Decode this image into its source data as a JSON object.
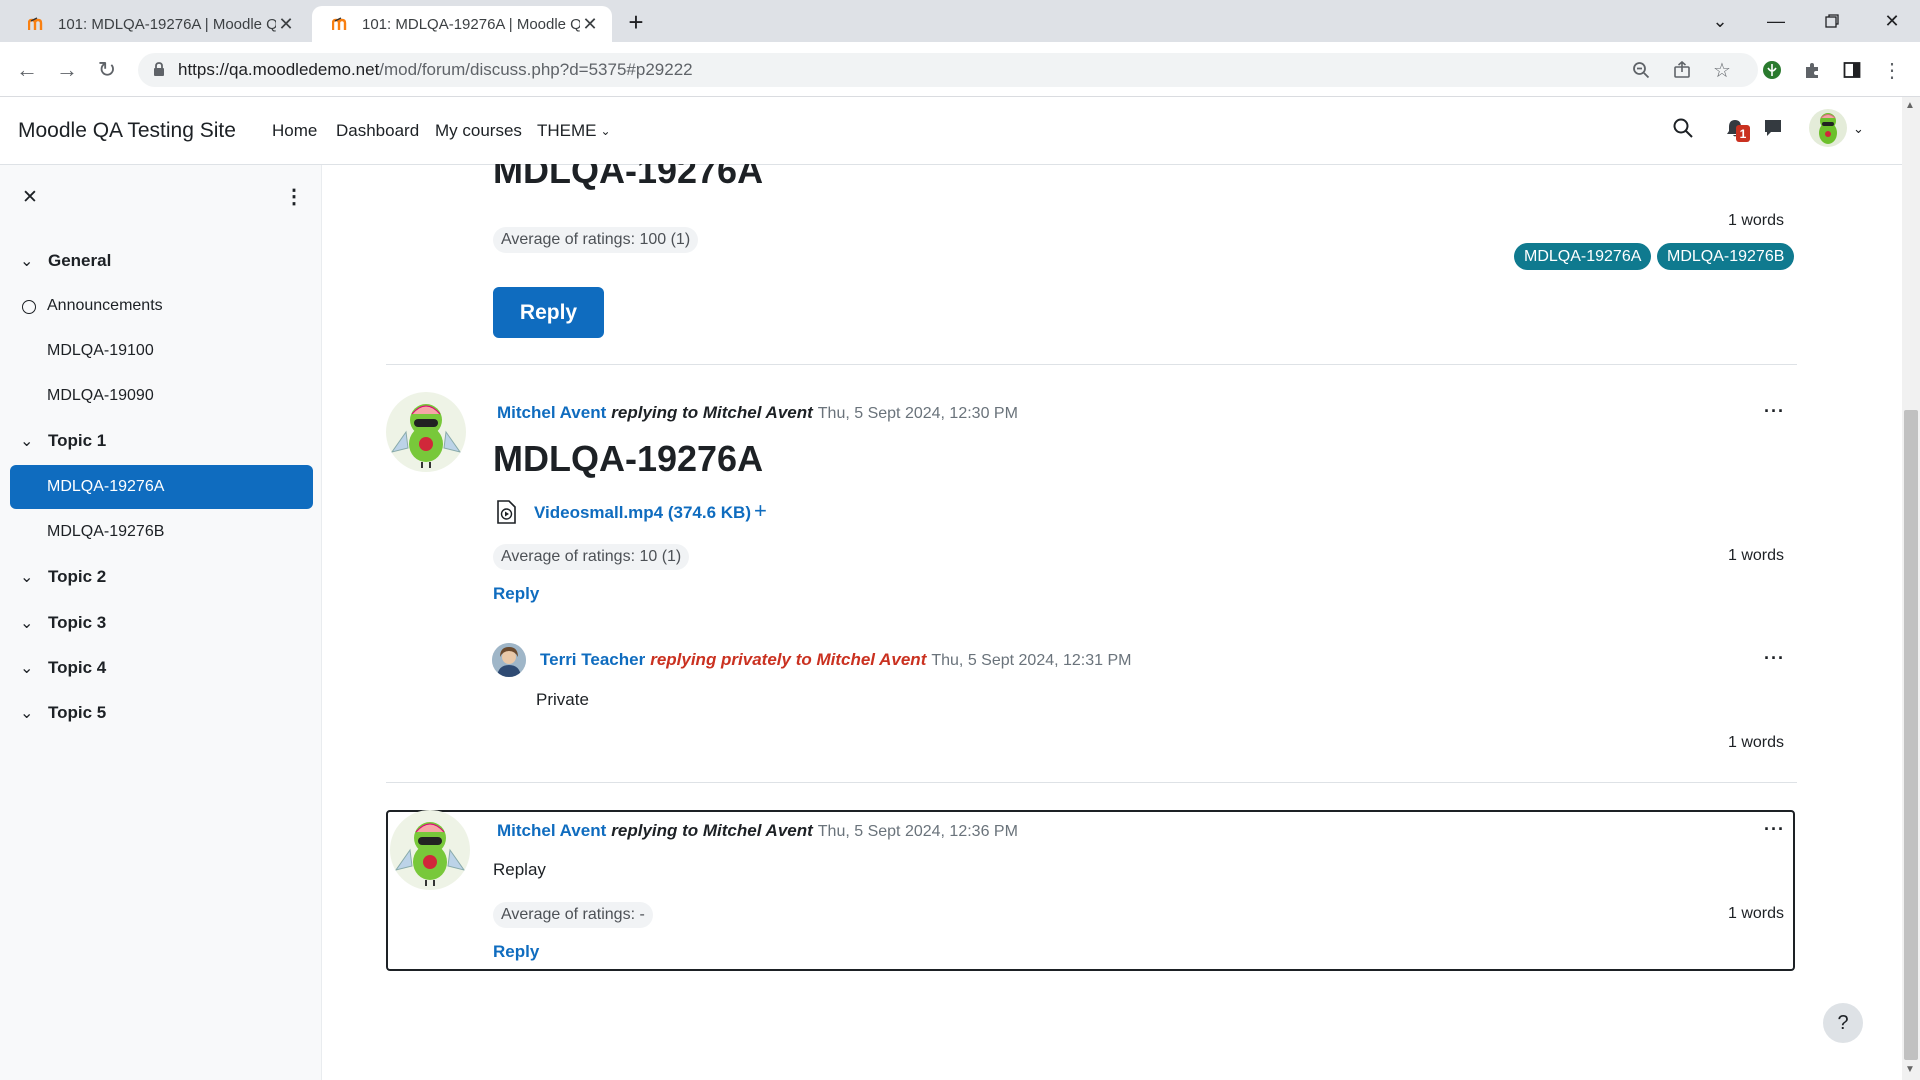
{
  "browser": {
    "tabs": [
      {
        "title": "101: MDLQA-19276A | Moodle Q"
      },
      {
        "title": "101: MDLQA-19276A | Moodle Q"
      }
    ],
    "url_host": "https://qa.moodledemo.net",
    "url_path": "/mod/forum/discuss.php?d=5375#p29222"
  },
  "navbar": {
    "site_name": "Moodle QA Testing Site",
    "links": [
      "Home",
      "Dashboard",
      "My courses",
      "THEME"
    ],
    "notification_count": "1"
  },
  "drawer": {
    "sections": [
      {
        "label": "General"
      },
      {
        "label": "Topic 1"
      },
      {
        "label": "Topic 2"
      },
      {
        "label": "Topic 3"
      },
      {
        "label": "Topic 4"
      },
      {
        "label": "Topic 5"
      }
    ],
    "general_items": [
      "Announcements",
      "MDLQA-19100",
      "MDLQA-19090"
    ],
    "topic1_items": [
      "MDLQA-19276A",
      "MDLQA-19276B"
    ]
  },
  "posts": {
    "top": {
      "title": "MDLQA-19276A",
      "rating": "Average of ratings: 100 (1)",
      "words": "1 words",
      "tags": [
        "MDLQA-19276A",
        "MDLQA-19276B"
      ],
      "reply_label": "Reply"
    },
    "p2": {
      "author": "Mitchel Avent",
      "meta": "replying to Mitchel Avent",
      "date": "Thu, 5 Sept 2024, 12:30 PM",
      "title": "MDLQA-19276A",
      "attachment": "Videosmall.mp4 (374.6 KB)",
      "rating": "Average of ratings: 10 (1)",
      "words": "1 words",
      "reply_label": "Reply"
    },
    "p3": {
      "author": "Terri Teacher",
      "meta": "replying privately to Mitchel Avent",
      "date": "Thu, 5 Sept 2024, 12:31 PM",
      "body": "Private",
      "words": "1 words"
    },
    "p4": {
      "author": "Mitchel Avent",
      "meta": "replying to Mitchel Avent",
      "date": "Thu, 5 Sept 2024, 12:36 PM",
      "body": "Replay",
      "rating": "Average of ratings: -",
      "words": "1 words",
      "reply_label": "Reply"
    }
  },
  "help_label": "?"
}
